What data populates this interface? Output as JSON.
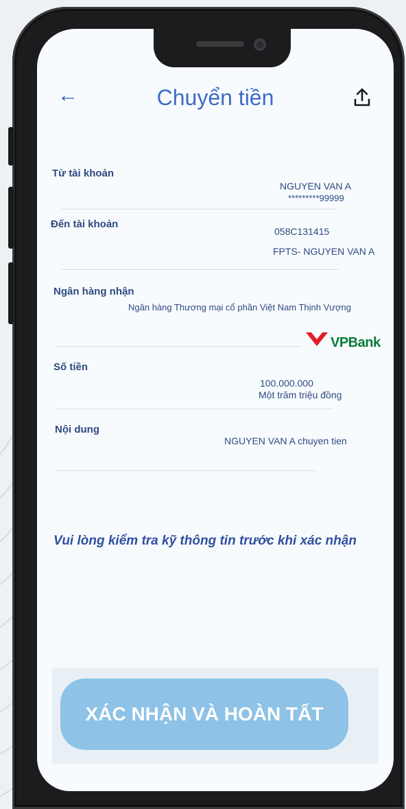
{
  "header": {
    "title": "Chuyển tiền"
  },
  "from_account": {
    "label": "Từ tài khoản",
    "name": "NGUYEN VAN A",
    "number": "*********99999"
  },
  "to_account": {
    "label": "Đến tài khoản",
    "number": "058C131415",
    "name": "FPTS- NGUYEN VAN A"
  },
  "bank": {
    "label": "Ngân hàng nhận",
    "name": "Ngân hàng Thương mại cổ phần Việt Nam Thịnh Vượng",
    "logo_text": "VPBank"
  },
  "amount": {
    "label": "Số tiền",
    "value": "100.000.000",
    "words": "Một trăm triệu đồng"
  },
  "content": {
    "label": "Nội dung",
    "value": "NGUYEN VAN A chuyen tien"
  },
  "notice": "Vui lòng kiểm tra kỹ thông tin trước khi xác nhận",
  "confirm_button": "XÁC NHẬN VÀ HOÀN TẤT",
  "colors": {
    "primary": "#3d6cc6",
    "button": "#8ec2e6",
    "vpbank_red": "#e31e24",
    "vpbank_green": "#0a7a3a"
  }
}
